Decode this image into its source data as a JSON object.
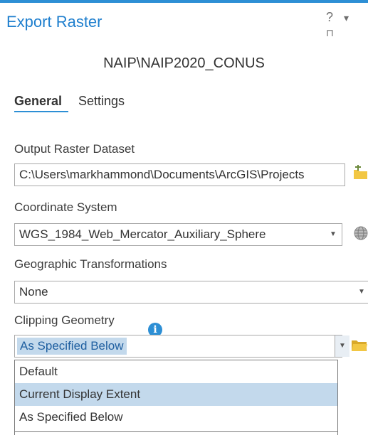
{
  "window": {
    "title": "Export Raster",
    "help_glyph": "?",
    "menu_glyph": "▾",
    "pin_glyph": "⊓"
  },
  "layer_name": "NAIP\\NAIP2020_CONUS",
  "tabs": [
    {
      "label": "General",
      "active": true
    },
    {
      "label": "Settings",
      "active": false
    }
  ],
  "output_raster": {
    "label": "Output Raster Dataset",
    "value": "C:\\Users\\markhammond\\Documents\\ArcGIS\\Projects"
  },
  "coordinate_system": {
    "label": "Coordinate System",
    "value": "WGS_1984_Web_Mercator_Auxiliary_Sphere"
  },
  "geo_transform": {
    "label": "Geographic Transformations",
    "value": "None"
  },
  "clipping": {
    "label": "Clipping Geometry",
    "info_glyph": "i",
    "value": "As Specified Below",
    "options": [
      "Default",
      "Current Display Extent",
      "As Specified Below"
    ],
    "highlighted_option": "Current Display Extent"
  },
  "icons": {
    "add_folder": "folder-add-icon",
    "globe": "globe-icon",
    "folder": "folder-icon",
    "info": "info-icon"
  },
  "colors": {
    "accent": "#2d8fd5",
    "highlight": "#c3d9ec",
    "folder": "#f2c744"
  }
}
